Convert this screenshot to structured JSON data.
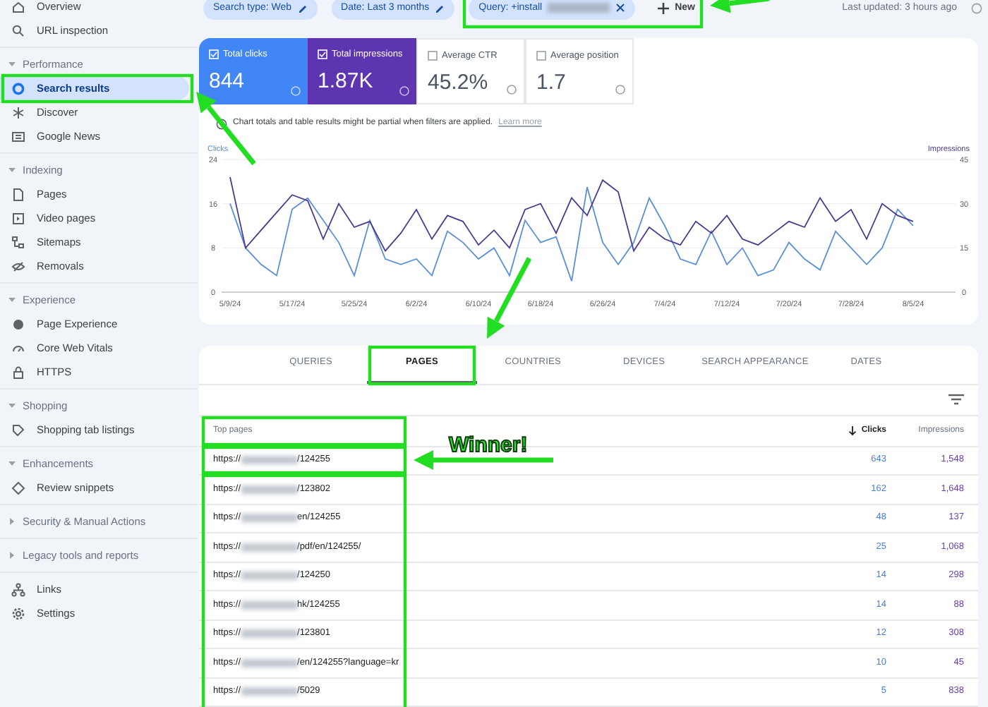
{
  "sidebar": {
    "groups": [
      {
        "items": [
          {
            "label": "Overview",
            "selected": false
          },
          {
            "label": "URL inspection",
            "selected": false
          }
        ]
      },
      {
        "title": "Performance",
        "expanded": true,
        "items": [
          {
            "label": "Search results",
            "selected": true
          },
          {
            "label": "Discover",
            "selected": false
          },
          {
            "label": "Google News",
            "selected": false
          }
        ]
      },
      {
        "title": "Indexing",
        "expanded": true,
        "items": [
          {
            "label": "Pages",
            "selected": false
          },
          {
            "label": "Video pages",
            "selected": false
          },
          {
            "label": "Sitemaps",
            "selected": false
          },
          {
            "label": "Removals",
            "selected": false
          }
        ]
      },
      {
        "title": "Experience",
        "expanded": true,
        "items": [
          {
            "label": "Page Experience",
            "selected": false
          },
          {
            "label": "Core Web Vitals",
            "selected": false
          },
          {
            "label": "HTTPS",
            "selected": false
          }
        ]
      },
      {
        "title": "Shopping",
        "expanded": true,
        "items": [
          {
            "label": "Shopping tab listings",
            "selected": false
          }
        ]
      },
      {
        "title": "Enhancements",
        "expanded": true,
        "items": [
          {
            "label": "Review snippets",
            "selected": false
          }
        ]
      },
      {
        "title": "Security & Manual Actions",
        "expanded": false
      },
      {
        "title": "Legacy tools and reports",
        "expanded": false
      },
      {
        "items": [
          {
            "label": "Links",
            "selected": false
          },
          {
            "label": "Settings",
            "selected": false
          }
        ]
      }
    ]
  },
  "filters": {
    "chips": [
      {
        "label": "Search type: Web",
        "kind": "edit",
        "redacted": false
      },
      {
        "label": "Date: Last 3 months",
        "kind": "edit",
        "redacted": false
      },
      {
        "label": "Query: +install",
        "kind": "remove",
        "redacted": true
      }
    ],
    "new_button": "New",
    "last_updated": "Last updated: 3 hours ago"
  },
  "metrics": [
    {
      "label": "Total clicks",
      "value": "844",
      "checked": true,
      "color": "#4285f4"
    },
    {
      "label": "Total impressions",
      "value": "1.87K",
      "checked": true,
      "color": "#5e35b1"
    },
    {
      "label": "Average CTR",
      "value": "45.2%",
      "checked": false
    },
    {
      "label": "Average position",
      "value": "1.7",
      "checked": false
    }
  ],
  "notice": {
    "text": "Chart totals and table results might be partial when filters are applied.",
    "link": "Learn more"
  },
  "chart": {
    "chart_data": {
      "type": "line",
      "categories": [
        "5/9/24",
        null,
        null,
        null,
        "5/17/24",
        null,
        null,
        null,
        "5/25/24",
        null,
        null,
        null,
        "6/2/24",
        null,
        null,
        null,
        "6/10/24",
        null,
        null,
        null,
        "6/18/24",
        null,
        null,
        null,
        "6/26/24",
        null,
        null,
        null,
        "7/4/24",
        null,
        null,
        null,
        "7/12/24",
        null,
        null,
        null,
        "7/20/24",
        null,
        null,
        null,
        "7/28/24",
        null,
        null,
        null,
        "8/5/24"
      ],
      "ylim": [
        0,
        24
      ],
      "yticks": [
        0,
        8,
        16,
        24
      ],
      "y2lim": [
        0,
        45
      ],
      "y2ticks": [
        0,
        15,
        30,
        45
      ],
      "series": [
        {
          "name": "Clicks",
          "color": "#5b8fd9",
          "values": [
            16,
            8,
            5,
            3,
            15,
            17,
            13,
            9,
            3,
            13,
            6,
            5,
            6,
            3,
            11,
            9,
            6,
            8,
            3,
            13,
            9,
            10,
            2,
            19,
            9,
            5,
            9,
            17,
            12,
            6,
            5,
            11,
            5,
            8,
            3,
            4,
            9,
            6,
            4,
            11,
            8,
            5,
            8,
            15,
            12
          ]
        },
        {
          "name": "Impressions",
          "color": "#4a3a8f",
          "axis": "y2",
          "values": [
            39,
            15,
            21,
            27,
            33,
            31,
            18,
            30,
            22,
            24,
            14,
            20,
            28,
            18,
            26,
            24,
            16,
            21,
            15,
            28,
            30,
            20,
            32,
            26,
            38,
            34,
            14,
            22,
            18,
            16,
            24,
            20,
            26,
            18,
            16,
            20,
            24,
            22,
            32,
            24,
            28,
            18,
            30,
            26,
            24
          ]
        }
      ]
    }
  },
  "tabs": [
    {
      "label": "QUERIES",
      "selected": false
    },
    {
      "label": "PAGES",
      "selected": true
    },
    {
      "label": "COUNTRIES",
      "selected": false
    },
    {
      "label": "DEVICES",
      "selected": false
    },
    {
      "label": "SEARCH APPEARANCE",
      "selected": false
    },
    {
      "label": "DATES",
      "selected": false
    }
  ],
  "table": {
    "columns": [
      {
        "label": "Top pages",
        "sorted": false
      },
      {
        "label": "Clicks",
        "sorted": true
      },
      {
        "label": "Impressions",
        "sorted": false
      }
    ],
    "rows": [
      {
        "page_prefix": "https://",
        "page_suffix": "/124255",
        "clicks": "643",
        "impressions": "1,548"
      },
      {
        "page_prefix": "https://",
        "page_suffix": "/123802",
        "clicks": "162",
        "impressions": "1,648"
      },
      {
        "page_prefix": "https://",
        "page_suffix": "en/124255",
        "clicks": "48",
        "impressions": "137"
      },
      {
        "page_prefix": "https://",
        "page_suffix": "/pdf/en/124255/",
        "clicks": "25",
        "impressions": "1,068"
      },
      {
        "page_prefix": "https://",
        "page_suffix": "/124250",
        "clicks": "14",
        "impressions": "298"
      },
      {
        "page_prefix": "https://",
        "page_suffix": "hk/124255",
        "clicks": "14",
        "impressions": "88"
      },
      {
        "page_prefix": "https://",
        "page_suffix": "/123801",
        "clicks": "12",
        "impressions": "308"
      },
      {
        "page_prefix": "https://",
        "page_suffix": "/en/124255?language=kr",
        "clicks": "10",
        "impressions": "45"
      },
      {
        "page_prefix": "https://",
        "page_suffix": "/5029",
        "clicks": "5",
        "impressions": "838"
      }
    ]
  },
  "annotation": {
    "text": "Winner!"
  }
}
